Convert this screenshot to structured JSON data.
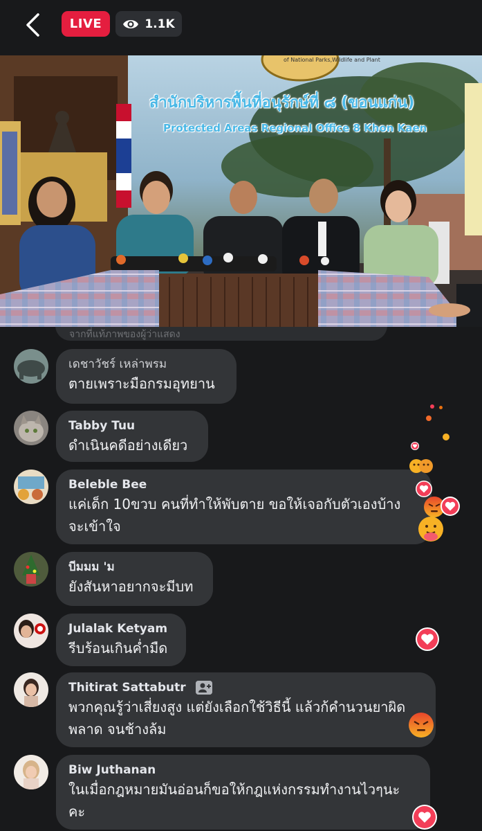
{
  "header": {
    "live_label": "LIVE",
    "viewer_count": "1.1K",
    "icons": {
      "back": "back-arrow-icon",
      "viewers": "eye-icon"
    },
    "colors": {
      "live": "#e41e3f",
      "pill": "#2d2f33"
    }
  },
  "video": {
    "banner_thai": "สำนักบริหารพื้นที่อนุรักษ์ที่ ๘ (ขอนแก่น)",
    "banner_english": "Protected Areas Regional Office 8 Khon Kaen",
    "seal_text": "of National Parks,Wildlife and Plant"
  },
  "comments": {
    "cut_off_text": "จากที่แท้ภาพของผู้ว่าแสดง",
    "items": [
      {
        "author": "เดชาวัชร์ เหล่าพรม",
        "text": "ตายเพราะมือกรมอุทยาน"
      },
      {
        "author": "Tabby Tuu",
        "text": "ดำเนินคดีอย่างเดียว"
      },
      {
        "author": "Beleble Bee",
        "text": "แค่เด็ก 10ขวบ คนที่ทำให้พับตาย ขอให้เจอกับตัวเองบ้าง",
        "text2": "จะเข้าใจ"
      },
      {
        "author": "บีมมม 'ม",
        "text": "ยังสันหาอยากจะมีบท"
      },
      {
        "author": "Julalak Ketyam",
        "text": "รีบร้อนเกินค่ำมืด"
      },
      {
        "author": "Thitirat Sattabutr",
        "text": "พวกคุณรู้ว่าเสี่ยงสูง แต่ยังเลือกใช้วิธีนี้ แล้วก้คำนวนยาผิด",
        "text2": "พลาด จนช้างล้ม"
      },
      {
        "author": "Biw Juthanan",
        "text": "ในเมื่อกฎหมายมันอ่อนก็ขอให้กฎแห่งกรรมทำงานไวๆนะ",
        "text2": "คะ"
      }
    ]
  },
  "reactions": {
    "icons": [
      "heart-reaction-icon",
      "angry-reaction-icon",
      "care-reaction-icon"
    ],
    "colors": {
      "heart": "#f33e58",
      "angry": "#e9710f",
      "care": "#f7b125"
    }
  }
}
